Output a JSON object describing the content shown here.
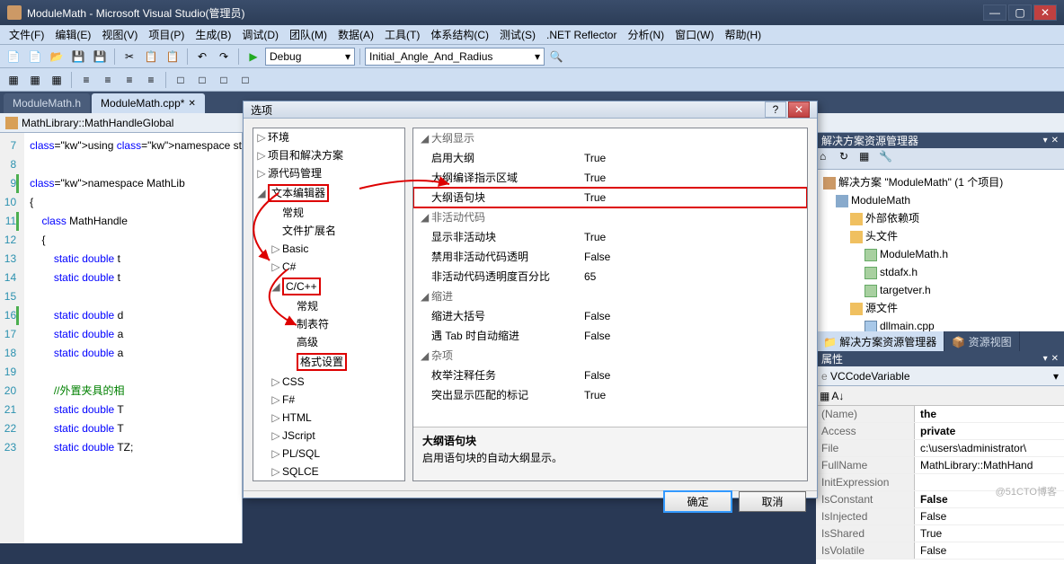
{
  "window": {
    "title": "ModuleMath - Microsoft Visual Studio(管理员)"
  },
  "menu": [
    "文件(F)",
    "编辑(E)",
    "视图(V)",
    "项目(P)",
    "生成(B)",
    "调试(D)",
    "团队(M)",
    "数据(A)",
    "工具(T)",
    "体系结构(C)",
    "测试(S)",
    ".NET Reflector",
    "分析(N)",
    "窗口(W)",
    "帮助(H)"
  ],
  "toolbar": {
    "config": "Debug",
    "target": "Initial_Angle_And_Radius"
  },
  "tabs": [
    {
      "label": "ModuleMath.h",
      "active": false
    },
    {
      "label": "ModuleMath.cpp*",
      "active": true
    }
  ],
  "nav": {
    "scope": "MathLibrary::MathHandleGlobal"
  },
  "code": {
    "lines": [
      7,
      8,
      9,
      10,
      11,
      12,
      13,
      14,
      15,
      16,
      17,
      18,
      19,
      20,
      21,
      22,
      23
    ],
    "text": [
      "using namespace st",
      "",
      "namespace MathLib",
      "{",
      "    class MathHandle",
      "    {",
      "        static double t",
      "        static double t",
      "",
      "        static double d",
      "        static double a",
      "        static double a",
      "",
      "        //外置夹具的相",
      "        static double T",
      "        static double T",
      "        static double TZ;"
    ]
  },
  "dialog": {
    "title": "选项",
    "tree": [
      {
        "lv": 0,
        "tw": "▷",
        "label": "环境"
      },
      {
        "lv": 0,
        "tw": "▷",
        "label": "项目和解决方案"
      },
      {
        "lv": 0,
        "tw": "▷",
        "label": "源代码管理"
      },
      {
        "lv": 0,
        "tw": "◢",
        "label": "文本编辑器",
        "box": true
      },
      {
        "lv": 1,
        "tw": "",
        "label": "常规"
      },
      {
        "lv": 1,
        "tw": "",
        "label": "文件扩展名"
      },
      {
        "lv": 1,
        "tw": "▷",
        "label": "Basic"
      },
      {
        "lv": 1,
        "tw": "▷",
        "label": "C#"
      },
      {
        "lv": 1,
        "tw": "◢",
        "label": "C/C++",
        "box": true
      },
      {
        "lv": 2,
        "tw": "",
        "label": "常规"
      },
      {
        "lv": 2,
        "tw": "",
        "label": "制表符"
      },
      {
        "lv": 2,
        "tw": "",
        "label": "高级"
      },
      {
        "lv": 2,
        "tw": "",
        "label": "格式设置",
        "box": true
      },
      {
        "lv": 1,
        "tw": "▷",
        "label": "CSS"
      },
      {
        "lv": 1,
        "tw": "▷",
        "label": "F#"
      },
      {
        "lv": 1,
        "tw": "▷",
        "label": "HTML"
      },
      {
        "lv": 1,
        "tw": "▷",
        "label": "JScript"
      },
      {
        "lv": 1,
        "tw": "▷",
        "label": "PL/SQL"
      },
      {
        "lv": 1,
        "tw": "▷",
        "label": "SQLCE"
      }
    ],
    "props": [
      {
        "hdr": true,
        "tw": "◢",
        "k": "大纲显示"
      },
      {
        "k": "启用大纲",
        "v": "True"
      },
      {
        "k": "大纲编译指示区域",
        "v": "True"
      },
      {
        "k": "大纲语句块",
        "v": "True",
        "box": true
      },
      {
        "hdr": true,
        "tw": "◢",
        "k": "非活动代码"
      },
      {
        "k": "显示非活动块",
        "v": "True"
      },
      {
        "k": "禁用非活动代码透明",
        "v": "False"
      },
      {
        "k": "非活动代码透明度百分比",
        "v": "65"
      },
      {
        "hdr": true,
        "tw": "◢",
        "k": "缩进"
      },
      {
        "k": "缩进大括号",
        "v": "False"
      },
      {
        "k": "遇 Tab 时自动缩进",
        "v": "False"
      },
      {
        "hdr": true,
        "tw": "◢",
        "k": "杂项"
      },
      {
        "k": "枚举注释任务",
        "v": "False"
      },
      {
        "k": "突出显示匹配的标记",
        "v": "True"
      }
    ],
    "desc": {
      "title": "大纲语句块",
      "text": "启用语句块的自动大纲显示。"
    },
    "ok": "确定",
    "cancel": "取消"
  },
  "solExplorer": {
    "title": "解决方案资源管理器",
    "root": "解决方案 \"ModuleMath\" (1 个项目)",
    "items": [
      {
        "lv": 1,
        "ic": "proj",
        "label": "ModuleMath"
      },
      {
        "lv": 2,
        "ic": "fold",
        "label": "外部依赖项"
      },
      {
        "lv": 2,
        "ic": "fold",
        "label": "头文件",
        "open": true
      },
      {
        "lv": 3,
        "ic": "h",
        "label": "ModuleMath.h"
      },
      {
        "lv": 3,
        "ic": "h",
        "label": "stdafx.h"
      },
      {
        "lv": 3,
        "ic": "h",
        "label": "targetver.h"
      },
      {
        "lv": 2,
        "ic": "fold",
        "label": "源文件",
        "open": true
      },
      {
        "lv": 3,
        "ic": "cpp",
        "label": "dllmain.cpp"
      },
      {
        "lv": 3,
        "ic": "cpp",
        "label": "ModuleMath.cpp"
      }
    ]
  },
  "bottomTabs": {
    "a": "解决方案资源管理器",
    "b": "资源视图"
  },
  "propPane": {
    "title": "属性",
    "obj": "VCCodeVariable",
    "rows": [
      {
        "k": "(Name)",
        "v": "the",
        "b": true
      },
      {
        "k": "Access",
        "v": "private",
        "b": true
      },
      {
        "k": "File",
        "v": "c:\\users\\administrator\\"
      },
      {
        "k": "FullName",
        "v": "MathLibrary::MathHand"
      },
      {
        "k": "InitExpression",
        "v": ""
      },
      {
        "k": "IsConstant",
        "v": "False",
        "b": true
      },
      {
        "k": "IsInjected",
        "v": "False"
      },
      {
        "k": "IsShared",
        "v": "True"
      },
      {
        "k": "IsVolatile",
        "v": "False"
      }
    ]
  },
  "watermark": "@51CTO博客"
}
